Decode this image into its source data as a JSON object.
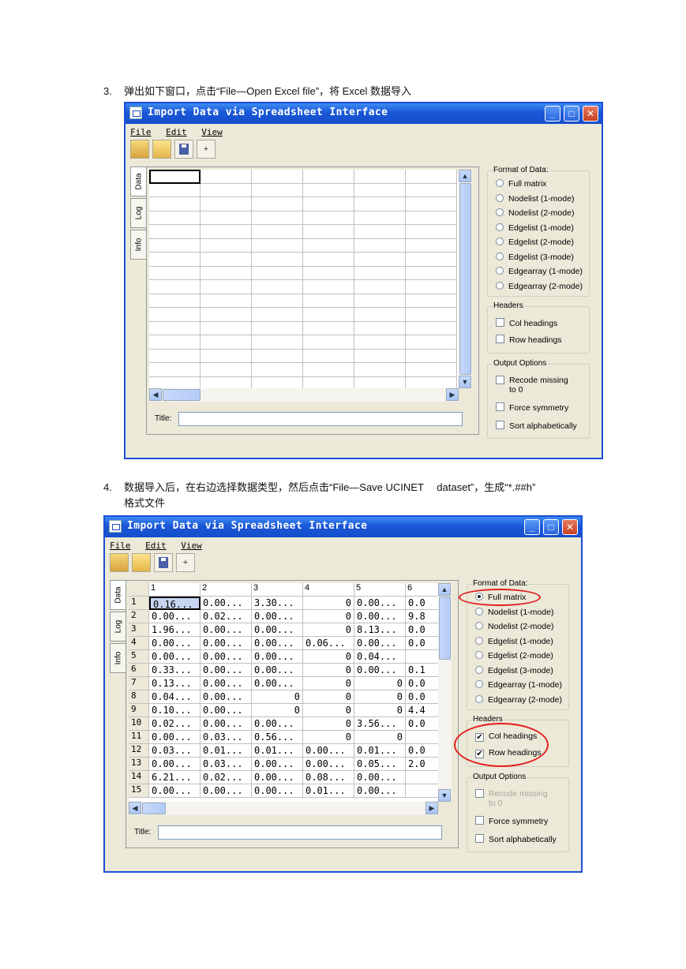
{
  "step3": {
    "number": "3.",
    "text": "弹出如下窗口，点击“File—Open Excel file”，将 Excel 数据导入"
  },
  "step4": {
    "number": "4.",
    "line1": "数据导入后，在右边选择数据类型，然后点击“File—Save UCINET　 dataset”，生成“*.##h”",
    "line2": "格式文件"
  },
  "window1": {
    "title": "Import Data via Spreadsheet Interface",
    "menu": [
      "File",
      "Edit",
      "View"
    ],
    "tabs": [
      "Data",
      "Log",
      "Info"
    ],
    "title_label": "Title:",
    "format_legend": "Format of Data:",
    "formats": [
      "Full matrix",
      "Nodelist (1-mode)",
      "Nodelist (2-mode)",
      "Edgelist (1-mode)",
      "Edgelist (2-mode)",
      "Edgelist (3-mode)",
      "Edgearray (1-mode)",
      "Edgearray (2-mode)"
    ],
    "selected_format": null,
    "headers_legend": "Headers",
    "headers": [
      {
        "label": "Col headings",
        "checked": false
      },
      {
        "label": "Row headings",
        "checked": false
      }
    ],
    "output_legend": "Output Options",
    "output": [
      {
        "label": "Recode missing to 0",
        "checked": false,
        "disabled": false
      },
      {
        "label": "Force symmetry",
        "checked": false
      },
      {
        "label": "Sort alphabetically",
        "checked": false
      }
    ]
  },
  "window2": {
    "title": "Import Data via Spreadsheet Interface",
    "menu": [
      "File",
      "Edit",
      "View"
    ],
    "tabs": [
      "Data",
      "Log",
      "Info"
    ],
    "title_label": "Title:",
    "grid": {
      "columns": [
        "1",
        "2",
        "3",
        "4",
        "5",
        "6"
      ],
      "rows": [
        {
          "h": "1",
          "c": [
            "0.16...",
            "0.00...",
            "3.30...",
            "0",
            "0.00...",
            "0.0"
          ]
        },
        {
          "h": "2",
          "c": [
            "0.00...",
            "0.02...",
            "0.00...",
            "0",
            "0.00...",
            "9.8"
          ]
        },
        {
          "h": "3",
          "c": [
            "1.96...",
            "0.00...",
            "0.00...",
            "0",
            "8.13...",
            "0.0"
          ]
        },
        {
          "h": "4",
          "c": [
            "0.00...",
            "0.00...",
            "0.00...",
            "0.06...",
            "0.00...",
            "0.0"
          ]
        },
        {
          "h": "5",
          "c": [
            "0.00...",
            "0.00...",
            "0.00...",
            "0",
            "0.04...",
            ""
          ]
        },
        {
          "h": "6",
          "c": [
            "0.33...",
            "0.00...",
            "0.00...",
            "0",
            "0.00...",
            "0.1"
          ]
        },
        {
          "h": "7",
          "c": [
            "0.13...",
            "0.00...",
            "0.00...",
            "0",
            "0",
            "0.0"
          ]
        },
        {
          "h": "8",
          "c": [
            "0.04...",
            "0.00...",
            "0",
            "0",
            "0",
            "0.0"
          ]
        },
        {
          "h": "9",
          "c": [
            "0.10...",
            "0.00...",
            "0",
            "0",
            "0",
            "4.4"
          ]
        },
        {
          "h": "10",
          "c": [
            "0.02...",
            "0.00...",
            "0.00...",
            "0",
            "3.56...",
            "0.0"
          ]
        },
        {
          "h": "11",
          "c": [
            "0.00...",
            "0.03...",
            "0.56...",
            "0",
            "0",
            ""
          ]
        },
        {
          "h": "12",
          "c": [
            "0.03...",
            "0.01...",
            "0.01...",
            "0.00...",
            "0.01...",
            "0.0"
          ]
        },
        {
          "h": "13",
          "c": [
            "0.00...",
            "0.03...",
            "0.00...",
            "0.00...",
            "0.05...",
            "2.0"
          ]
        },
        {
          "h": "14",
          "c": [
            "6.21...",
            "0.02...",
            "0.00...",
            "0.08...",
            "0.00...",
            ""
          ]
        },
        {
          "h": "15",
          "c": [
            "0.00...",
            "0.00...",
            "0.00...",
            "0.01...",
            "0.00...",
            ""
          ]
        }
      ]
    },
    "format_legend": "Format of Data:",
    "formats": [
      "Full matrix",
      "Nodelist (1-mode)",
      "Nodelist (2-mode)",
      "Edgelist (1-mode)",
      "Edgelist (2-mode)",
      "Edgelist (3-mode)",
      "Edgearray (1-mode)",
      "Edgearray (2-mode)"
    ],
    "selected_format": 0,
    "headers_legend": "Headers",
    "headers": [
      {
        "label": "Col headings",
        "checked": true
      },
      {
        "label": "Row headings",
        "checked": true
      }
    ],
    "output_legend": "Output Options",
    "output": [
      {
        "label": "Recode missing to 0",
        "checked": false,
        "disabled": true
      },
      {
        "label": "Force symmetry",
        "checked": false
      },
      {
        "label": "Sort alphabetically",
        "checked": false
      }
    ]
  },
  "colors": {
    "titlebar": "#1a56d6",
    "window_bg": "#ece9d8",
    "annotation": "#e21d1d"
  }
}
